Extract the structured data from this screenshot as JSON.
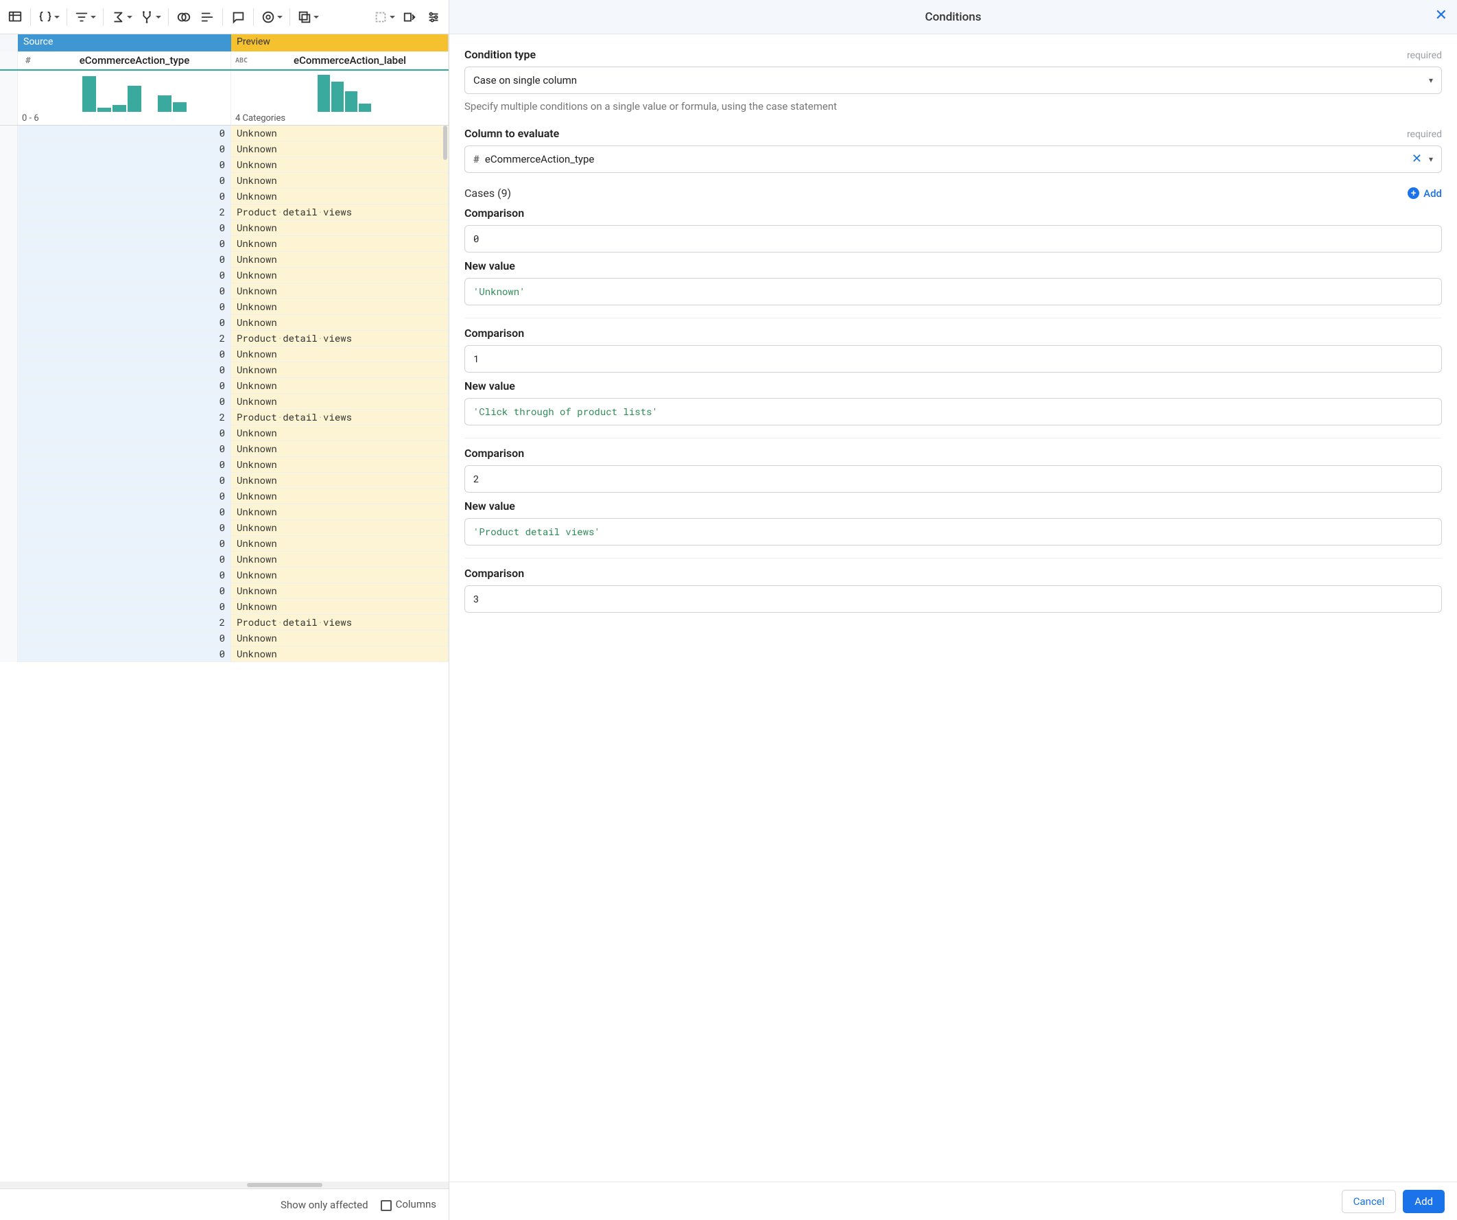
{
  "toolbar": {
    "icons": [
      "table-lock",
      "braces",
      "filter",
      "sigma",
      "merge",
      "ring",
      "lines",
      "comment",
      "target",
      "stack",
      "dashed-select",
      "to-end",
      "sliders"
    ]
  },
  "columns": {
    "source_band": "Source",
    "preview_band": "Preview",
    "source": {
      "type_icon": "#",
      "name": "eCommerceAction_type",
      "hist_caption": "0 - 6"
    },
    "preview": {
      "type_icon": "ABC",
      "name": "eCommerceAction_label",
      "hist_caption": "4 Categories"
    }
  },
  "rows": [
    {
      "v": "0",
      "l": "Unknown"
    },
    {
      "v": "0",
      "l": "Unknown"
    },
    {
      "v": "0",
      "l": "Unknown"
    },
    {
      "v": "0",
      "l": "Unknown"
    },
    {
      "v": "0",
      "l": "Unknown"
    },
    {
      "v": "2",
      "l": "Product·detail·views"
    },
    {
      "v": "0",
      "l": "Unknown"
    },
    {
      "v": "0",
      "l": "Unknown"
    },
    {
      "v": "0",
      "l": "Unknown"
    },
    {
      "v": "0",
      "l": "Unknown"
    },
    {
      "v": "0",
      "l": "Unknown"
    },
    {
      "v": "0",
      "l": "Unknown"
    },
    {
      "v": "0",
      "l": "Unknown"
    },
    {
      "v": "2",
      "l": "Product·detail·views"
    },
    {
      "v": "0",
      "l": "Unknown"
    },
    {
      "v": "0",
      "l": "Unknown"
    },
    {
      "v": "0",
      "l": "Unknown"
    },
    {
      "v": "0",
      "l": "Unknown"
    },
    {
      "v": "2",
      "l": "Product·detail·views"
    },
    {
      "v": "0",
      "l": "Unknown"
    },
    {
      "v": "0",
      "l": "Unknown"
    },
    {
      "v": "0",
      "l": "Unknown"
    },
    {
      "v": "0",
      "l": "Unknown"
    },
    {
      "v": "0",
      "l": "Unknown"
    },
    {
      "v": "0",
      "l": "Unknown"
    },
    {
      "v": "0",
      "l": "Unknown"
    },
    {
      "v": "0",
      "l": "Unknown"
    },
    {
      "v": "0",
      "l": "Unknown"
    },
    {
      "v": "0",
      "l": "Unknown"
    },
    {
      "v": "0",
      "l": "Unknown"
    },
    {
      "v": "0",
      "l": "Unknown"
    },
    {
      "v": "2",
      "l": "Product·detail·views"
    },
    {
      "v": "0",
      "l": "Unknown"
    },
    {
      "v": "0",
      "l": "Unknown"
    }
  ],
  "footer": {
    "show_only_affected": "Show only affected",
    "columns": "Columns"
  },
  "panel": {
    "title": "Conditions",
    "condition_type": {
      "label": "Condition type",
      "required": "required",
      "value": "Case on single column",
      "helper": "Specify multiple conditions on a single value or formula, using the case statement"
    },
    "column_to_evaluate": {
      "label": "Column to evaluate",
      "required": "required",
      "icon": "#",
      "value": "eCommerceAction_type"
    },
    "cases_label": "Cases (9)",
    "add_label": "Add",
    "comparison_label": "Comparison",
    "newvalue_label": "New value",
    "cases": [
      {
        "comparison": "0",
        "newvalue": "'Unknown'"
      },
      {
        "comparison": "1",
        "newvalue": "'Click through of product lists'"
      },
      {
        "comparison": "2",
        "newvalue": "'Product detail views'"
      },
      {
        "comparison": "3",
        "newvalue": ""
      }
    ],
    "buttons": {
      "cancel": "Cancel",
      "add": "Add"
    }
  }
}
